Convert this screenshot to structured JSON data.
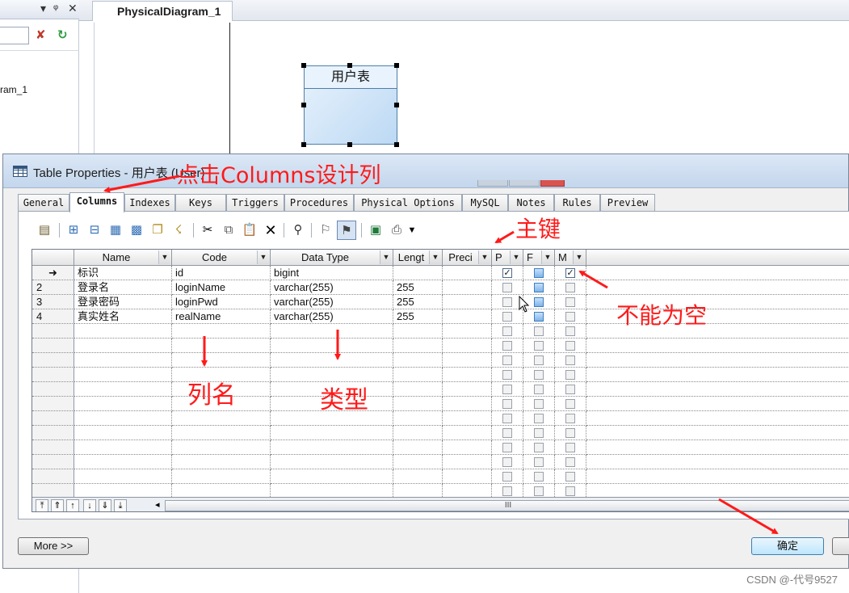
{
  "ide": {
    "diagram_tab": "PhysicalDiagram_1",
    "tree_item": "ram_1",
    "entity_title": "用户表"
  },
  "dialog": {
    "title": "Table Properties - 用户表 (User)",
    "tabs": [
      "General",
      "Columns",
      "Indexes",
      "Keys",
      "Triggers",
      "Procedures",
      "Physical Options",
      "MySQL",
      "Notes",
      "Rules",
      "Preview"
    ],
    "active_tab": "Columns",
    "columns": {
      "headers": [
        "Name",
        "Code",
        "Data Type",
        "Lengt",
        "Preci",
        "P",
        "F",
        "M"
      ],
      "rows": [
        {
          "marker": "➜",
          "name": "标识",
          "code": "id",
          "data_type": "bigint",
          "length": "",
          "precision": "",
          "p": true,
          "f": false,
          "m": true
        },
        {
          "marker": "2",
          "name": "登录名",
          "code": "loginName",
          "data_type": "varchar(255)",
          "length": "255",
          "precision": "",
          "p": false,
          "f": false,
          "m": false
        },
        {
          "marker": "3",
          "name": "登录密码",
          "code": "loginPwd",
          "data_type": "varchar(255)",
          "length": "255",
          "precision": "",
          "p": false,
          "f": false,
          "m": false
        },
        {
          "marker": "4",
          "name": "真实姓名",
          "code": "realName",
          "data_type": "varchar(255)",
          "length": "255",
          "precision": "",
          "p": false,
          "f": false,
          "m": false
        }
      ],
      "empty_rows": 12
    },
    "scroll_label": "III",
    "more_label": "More >>",
    "ok_label": "确定"
  },
  "annotations": {
    "columns_tip": "点击Columns设计列",
    "primary_key": "主键",
    "not_null": "不能为空",
    "column_name": "列名",
    "type": "类型"
  },
  "watermark": "CSDN @-代号9527",
  "colors": {
    "annotation": "#ff1a1a",
    "dialog_bg": "#f0f0f0",
    "title_bar": "#c3d6ec",
    "entity_fill": "#bcd9f4"
  }
}
